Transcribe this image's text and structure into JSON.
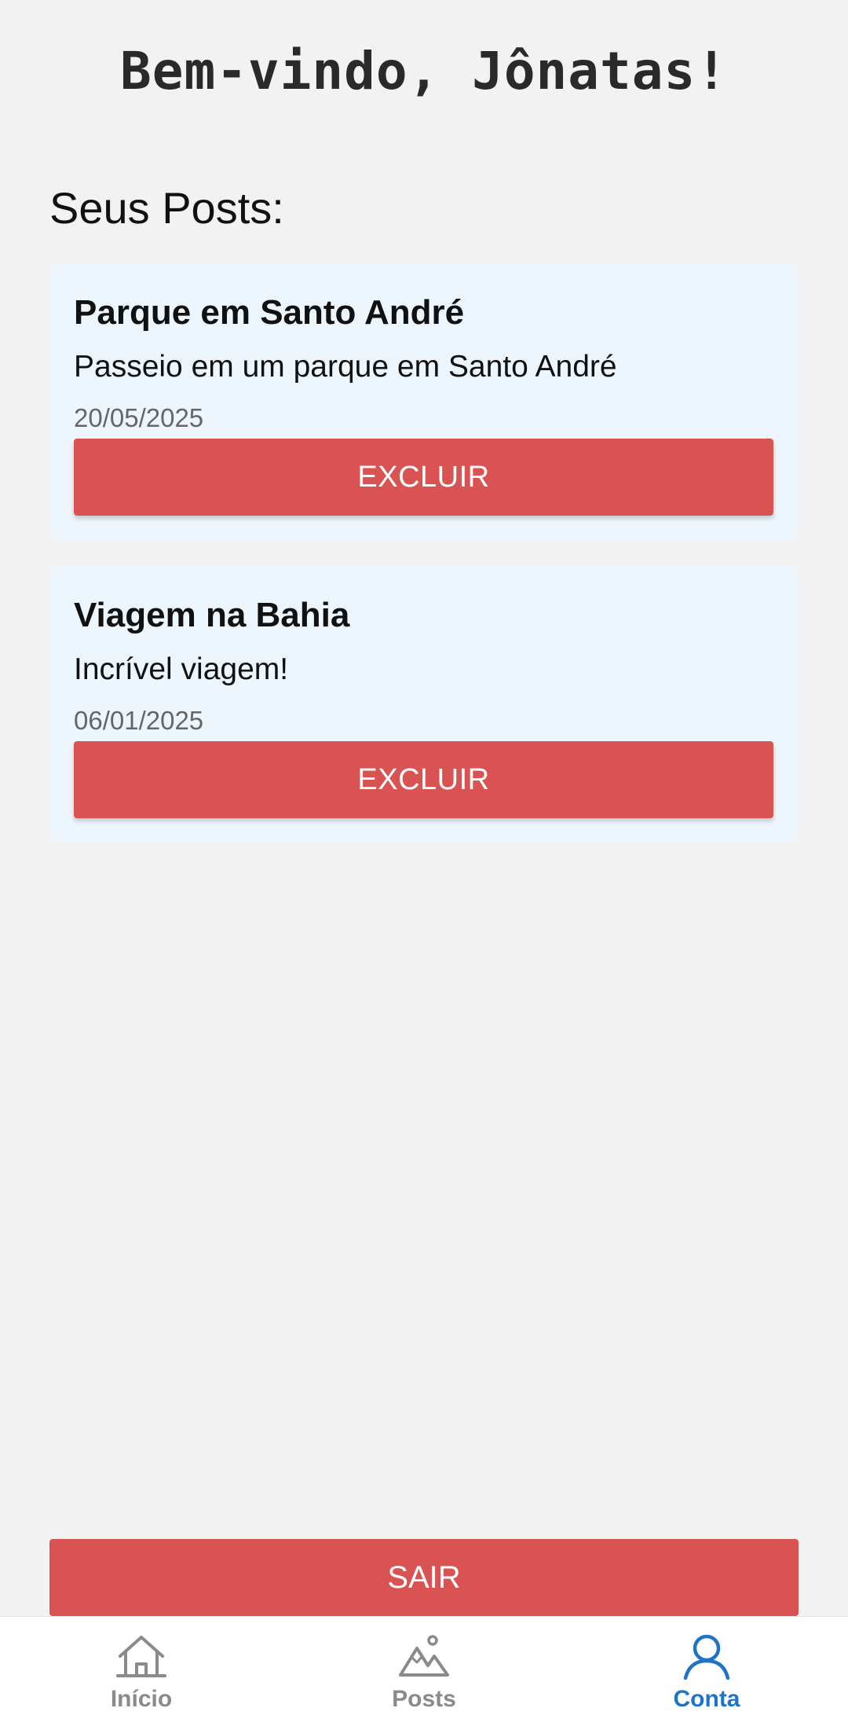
{
  "header": {
    "welcome": "Bem-vindo, Jônatas!"
  },
  "section": {
    "title": "Seus Posts:"
  },
  "posts": [
    {
      "title": "Parque em Santo André",
      "description": "Passeio em um parque em Santo André",
      "date": "20/05/2025",
      "delete_label": "EXCLUIR"
    },
    {
      "title": "Viagem na Bahia",
      "description": "Incrível viagem!",
      "date": "06/01/2025",
      "delete_label": "EXCLUIR"
    }
  ],
  "logout": {
    "label": "SAIR"
  },
  "nav": {
    "items": [
      {
        "label": "Início",
        "icon": "home-icon",
        "active": false
      },
      {
        "label": "Posts",
        "icon": "mountain-icon",
        "active": false
      },
      {
        "label": "Conta",
        "icon": "user-icon",
        "active": true
      }
    ]
  },
  "colors": {
    "background": "#f2f2f2",
    "card": "#eef6fd",
    "danger": "#d95352",
    "active_nav": "#1f74c8",
    "inactive_nav": "#8a8a8a"
  }
}
